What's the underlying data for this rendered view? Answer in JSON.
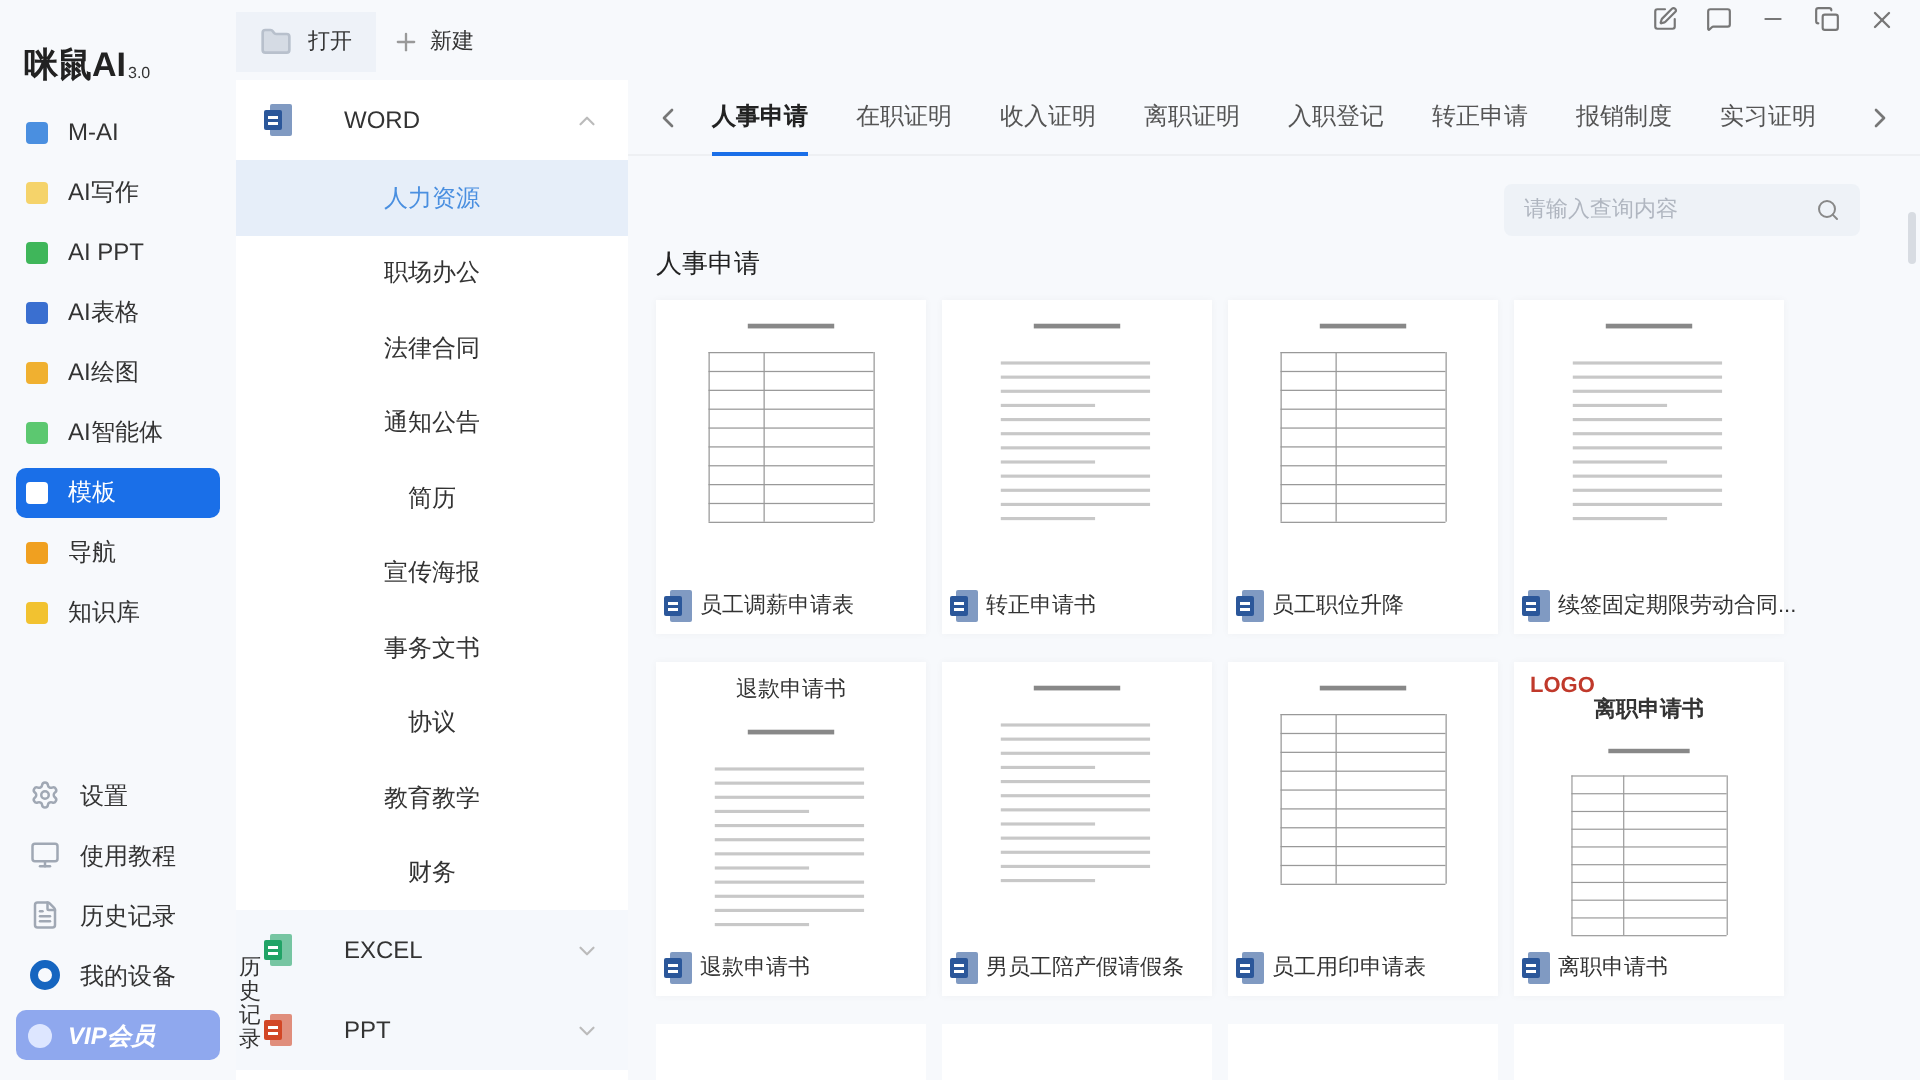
{
  "logo": {
    "name": "咪鼠AI",
    "version": "3.0"
  },
  "sidebar": {
    "items": [
      {
        "label": "M-AI",
        "color": "#4a8fe0",
        "selected": false
      },
      {
        "label": "AI写作",
        "color": "#f5d36a",
        "selected": false
      },
      {
        "label": "AI PPT",
        "color": "#3fb65a",
        "selected": false
      },
      {
        "label": "AI表格",
        "color": "#3a6fd0",
        "selected": false
      },
      {
        "label": "AI绘图",
        "color": "#f0b030",
        "selected": false
      },
      {
        "label": "AI智能体",
        "color": "#5cc870",
        "selected": false
      },
      {
        "label": "模板",
        "color": "#ffffff",
        "selected": true
      },
      {
        "label": "导航",
        "color": "#f0a020",
        "selected": false
      },
      {
        "label": "知识库",
        "color": "#f2c230",
        "selected": false
      }
    ],
    "bottom_items": [
      {
        "label": "设置",
        "kind": "gear"
      },
      {
        "label": "使用教程",
        "kind": "screen"
      },
      {
        "label": "历史记录",
        "kind": "doc"
      },
      {
        "label": "我的设备",
        "kind": "ring"
      }
    ],
    "vip": {
      "label": "VIP会员"
    }
  },
  "toolbar": {
    "open": "打开",
    "new": "新建"
  },
  "categories": [
    {
      "label": "WORD",
      "kind": "word",
      "expanded": true,
      "children": [
        {
          "label": "人力资源",
          "selected": true
        },
        {
          "label": "职场办公",
          "selected": false
        },
        {
          "label": "法律合同",
          "selected": false
        },
        {
          "label": "通知公告",
          "selected": false
        },
        {
          "label": "简历",
          "selected": false
        },
        {
          "label": "宣传海报",
          "selected": false
        },
        {
          "label": "事务文书",
          "selected": false
        },
        {
          "label": "协议",
          "selected": false
        },
        {
          "label": "教育教学",
          "selected": false
        },
        {
          "label": "财务",
          "selected": false
        }
      ]
    },
    {
      "label": "EXCEL",
      "kind": "excel",
      "expanded": false
    },
    {
      "label": "PPT",
      "kind": "ppt",
      "expanded": false
    }
  ],
  "history_tab": "历史记录",
  "tabs": [
    {
      "label": "人事申请",
      "selected": true
    },
    {
      "label": "在职证明",
      "selected": false
    },
    {
      "label": "收入证明",
      "selected": false
    },
    {
      "label": "离职证明",
      "selected": false
    },
    {
      "label": "入职登记",
      "selected": false
    },
    {
      "label": "转正申请",
      "selected": false
    },
    {
      "label": "报销制度",
      "selected": false
    },
    {
      "label": "实习证明",
      "selected": false
    }
  ],
  "search": {
    "placeholder": "请输入查询内容"
  },
  "section_title": "人事申请",
  "cards": [
    {
      "title": "员工调薪申请表",
      "kind": "form"
    },
    {
      "title": "转正申请书",
      "kind": "letter"
    },
    {
      "title": "员工职位升降",
      "kind": "form"
    },
    {
      "title": "续签固定期限劳动合同...",
      "kind": "letter"
    },
    {
      "title": "退款申请书",
      "kind": "letter",
      "heading": "退款申请书"
    },
    {
      "title": "男员工陪产假请假条",
      "kind": "letter"
    },
    {
      "title": "员工用印申请表",
      "kind": "form"
    },
    {
      "title": "离职申请书",
      "kind": "logo-form",
      "logo": "LOGO",
      "heading": "离职申请书"
    }
  ]
}
